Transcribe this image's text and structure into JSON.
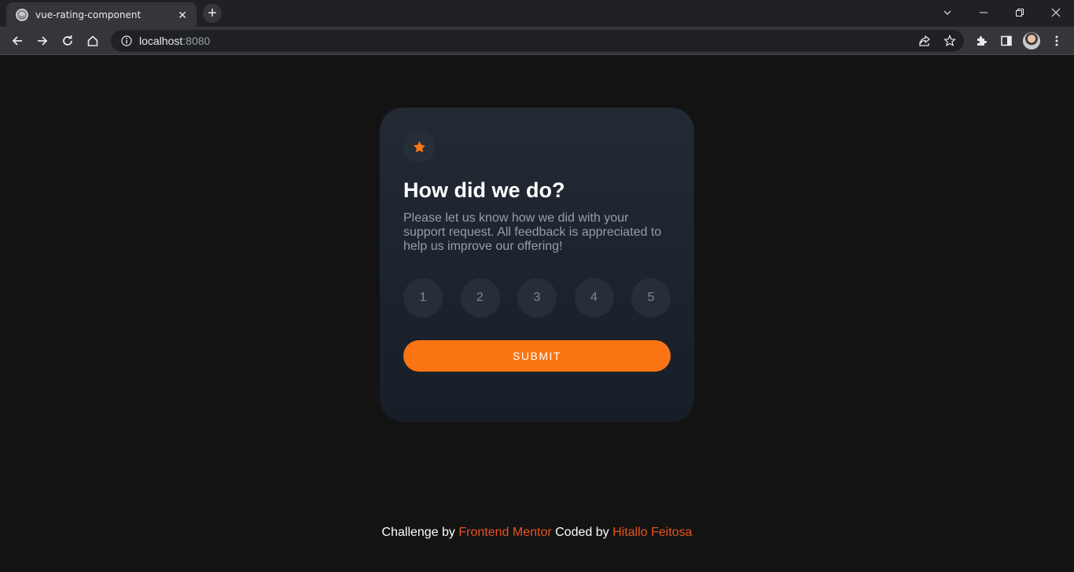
{
  "browser": {
    "tab_title": "vue-rating-component",
    "new_tab_symbol": "+",
    "tab_close_symbol": "✕",
    "url_host": "localhost",
    "url_port": ":8080",
    "icons": [
      "back-arrow-icon",
      "forward-arrow-icon",
      "reload-icon",
      "home-icon",
      "info-icon",
      "share-icon",
      "bookmark-star-icon",
      "extensions-icon",
      "side-panel-icon",
      "avatar",
      "kebab-menu-icon",
      "chevron-down-icon",
      "minimize-icon",
      "restore-icon",
      "close-window-icon"
    ]
  },
  "card": {
    "icon": "star-icon",
    "title": "How did we do?",
    "description": "Please let us know how we did with your support request. All feedback is appreciated to help us improve our offering!",
    "ratings": [
      "1",
      "2",
      "3",
      "4",
      "5"
    ],
    "submit_label": "SUBMIT"
  },
  "footer": {
    "prefix": "Challenge by",
    "challenge_link": "Frontend Mentor",
    "middle": "Coded by",
    "author_link": "Hitallo Feitosa"
  },
  "colors": {
    "page_bg": "#131313",
    "card_bg": "#1e2530",
    "accent": "#fb7413",
    "link": "#e8531f",
    "muted_text": "#959eac"
  }
}
